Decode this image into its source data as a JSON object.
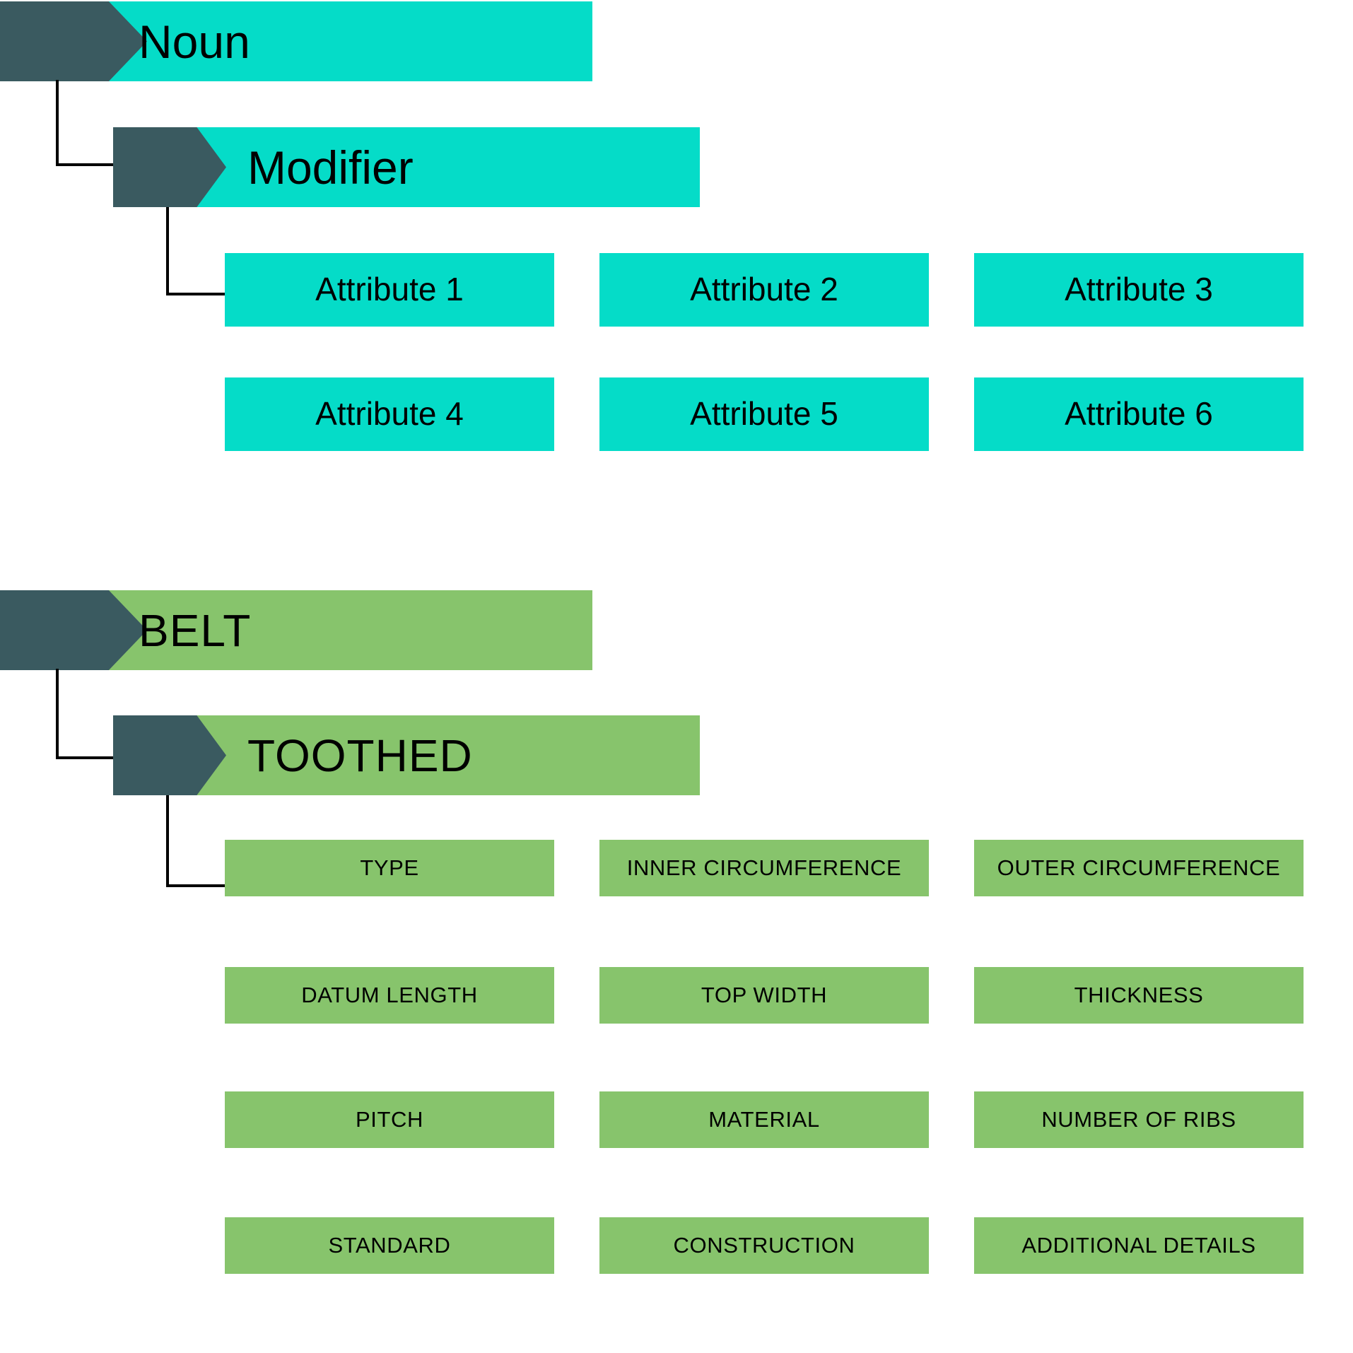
{
  "diagram": {
    "title_color_teal": "#05dcc8",
    "title_color_green": "#87c46c",
    "arrow_color": "#3a5a60",
    "connector_color": "#000000",
    "generic_section": {
      "noun": {
        "label": "Noun"
      },
      "modifier": {
        "label": "Modifier"
      },
      "attributes": [
        "Attribute 1",
        "Attribute 2",
        "Attribute 3",
        "Attribute 4",
        "Attribute 5",
        "Attribute 6"
      ]
    },
    "example_section": {
      "noun": {
        "label": "BELT"
      },
      "modifier": {
        "label": "TOOTHED"
      },
      "attributes": [
        "TYPE",
        "INNER CIRCUMFERENCE",
        "OUTER CIRCUMFERENCE",
        "DATUM LENGTH",
        "TOP WIDTH",
        "THICKNESS",
        "PITCH",
        "MATERIAL",
        "NUMBER OF RIBS",
        "STANDARD",
        "CONSTRUCTION",
        "ADDITIONAL DETAILS"
      ]
    }
  }
}
